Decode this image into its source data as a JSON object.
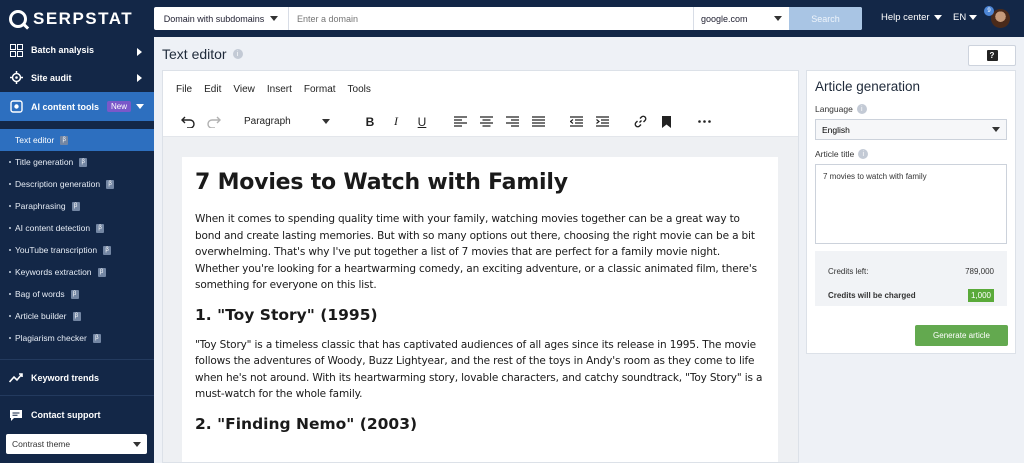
{
  "brand": {
    "name": "SERPSTAT"
  },
  "header": {
    "search_mode": "Domain with subdomains",
    "domain_placeholder": "Enter a domain",
    "engine": "google.com",
    "search_label": "Search",
    "help_center": "Help center",
    "language": "EN",
    "notifications": "9"
  },
  "sidebar": {
    "sections": [
      {
        "label": "Batch analysis",
        "icon": "batch-icon"
      },
      {
        "label": "Site audit",
        "icon": "audit-icon"
      },
      {
        "label": "AI content tools",
        "icon": "ai-icon",
        "badge": "New"
      }
    ],
    "tools": [
      {
        "label": "Text editor",
        "badge": "β"
      },
      {
        "label": "Title generation",
        "badge": "β"
      },
      {
        "label": "Description generation",
        "badge": "β"
      },
      {
        "label": "Paraphrasing",
        "badge": "β"
      },
      {
        "label": "AI content detection",
        "badge": "β"
      },
      {
        "label": "YouTube transcription",
        "badge": "β"
      },
      {
        "label": "Keywords extraction",
        "badge": "β"
      },
      {
        "label": "Bag of words",
        "badge": "β"
      },
      {
        "label": "Article builder",
        "badge": "β"
      },
      {
        "label": "Plagiarism checker",
        "badge": "β"
      }
    ],
    "keyword_trends": "Keyword trends",
    "contact_support": "Contact support",
    "theme": "Contrast theme"
  },
  "page": {
    "title": "Text editor",
    "help": "?"
  },
  "editor": {
    "menu": [
      "File",
      "Edit",
      "View",
      "Insert",
      "Format",
      "Tools"
    ],
    "block_format": "Paragraph",
    "document": {
      "h1": "7 Movies to Watch with Family",
      "intro": "When it comes to spending quality time with your family, watching movies together can be a great way to bond and create lasting memories. But with so many options out there, choosing the right movie can be a bit overwhelming. That's why I've put together a list of 7 movies that are perfect for a family movie night. Whether you're looking for a heartwarming comedy, an exciting adventure, or a classic animated film, there's something for everyone on this list.",
      "h2_1": "1. \"Toy Story\" (1995)",
      "p1": "\"Toy Story\" is a timeless classic that has captivated audiences of all ages since its release in 1995. The movie follows the adventures of Woody, Buzz Lightyear, and the rest of the toys in Andy's room as they come to life when he's not around. With its heartwarming story, lovable characters, and catchy soundtrack, \"Toy Story\" is a must-watch for the whole family.",
      "h2_2": "2. \"Finding Nemo\" (2003)"
    }
  },
  "article_panel": {
    "title": "Article generation",
    "language_label": "Language",
    "language_value": "English",
    "article_title_label": "Article title",
    "article_title_value": "7 movies to watch with family",
    "credits_left_label": "Credits left:",
    "credits_left_value": "789,000",
    "credits_charge_label": "Credits will be charged",
    "credits_charge_value": "1,000",
    "generate_label": "Generate article"
  },
  "colors": {
    "navy": "#132747",
    "active_blue": "#2d6fbf",
    "green": "#63a94f",
    "new_badge": "#7a58c9"
  }
}
